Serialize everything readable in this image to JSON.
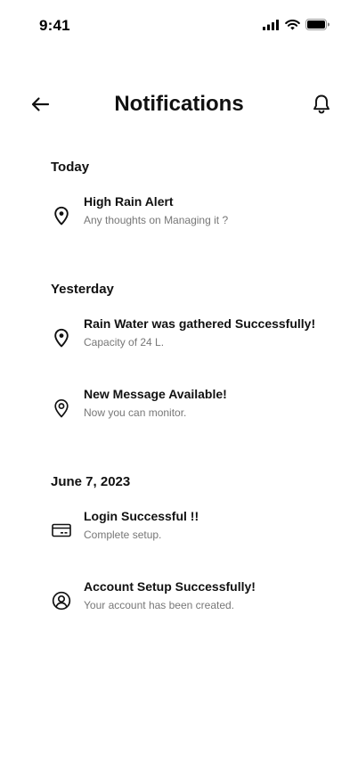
{
  "status_bar": {
    "time": "9:41"
  },
  "header": {
    "title": "Notifications"
  },
  "sections": [
    {
      "title": "Today",
      "items": [
        {
          "icon": "location-pin-icon",
          "title": "High Rain Alert",
          "subtitle": "Any thoughts on Managing it ?"
        }
      ]
    },
    {
      "title": "Yesterday",
      "items": [
        {
          "icon": "location-pin-icon",
          "title": "Rain Water was gathered Successfully!",
          "subtitle": "Capacity of 24 L."
        },
        {
          "icon": "location-pin-outline-icon",
          "title": "New Message Available!",
          "subtitle": "Now you can monitor."
        }
      ]
    },
    {
      "title": "June 7, 2023",
      "items": [
        {
          "icon": "credit-card-icon",
          "title": "Login Successful !!",
          "subtitle": "Complete setup."
        },
        {
          "icon": "user-circle-icon",
          "title": "Account Setup Successfully!",
          "subtitle": "Your account has been created."
        }
      ]
    }
  ]
}
